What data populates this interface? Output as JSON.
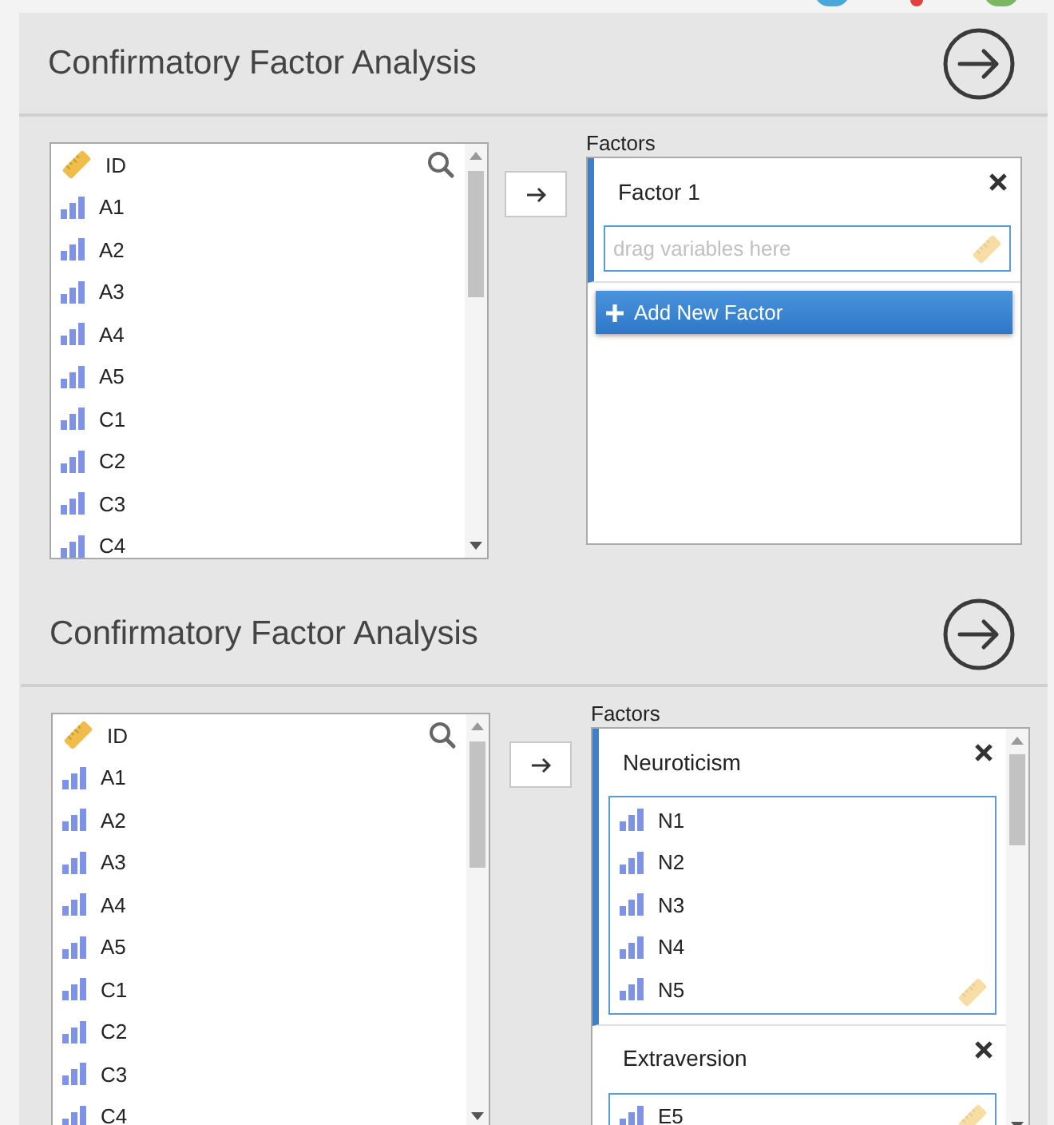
{
  "panels": [
    {
      "title": "Confirmatory Factor Analysis",
      "variables": [
        {
          "name": "ID",
          "kind": "id"
        },
        {
          "name": "A1",
          "kind": "ordinal"
        },
        {
          "name": "A2",
          "kind": "ordinal"
        },
        {
          "name": "A3",
          "kind": "ordinal"
        },
        {
          "name": "A4",
          "kind": "ordinal"
        },
        {
          "name": "A5",
          "kind": "ordinal"
        },
        {
          "name": "C1",
          "kind": "ordinal"
        },
        {
          "name": "C2",
          "kind": "ordinal"
        },
        {
          "name": "C3",
          "kind": "ordinal"
        },
        {
          "name": "C4",
          "kind": "ordinal"
        }
      ],
      "factors_label": "Factors",
      "factors": [
        {
          "title": "Factor 1",
          "placeholder": "drag variables here"
        }
      ],
      "add_button": "Add New Factor"
    },
    {
      "title": "Confirmatory Factor Analysis",
      "variables": [
        {
          "name": "ID",
          "kind": "id"
        },
        {
          "name": "A1",
          "kind": "ordinal"
        },
        {
          "name": "A2",
          "kind": "ordinal"
        },
        {
          "name": "A3",
          "kind": "ordinal"
        },
        {
          "name": "A4",
          "kind": "ordinal"
        },
        {
          "name": "A5",
          "kind": "ordinal"
        },
        {
          "name": "C1",
          "kind": "ordinal"
        },
        {
          "name": "C2",
          "kind": "ordinal"
        },
        {
          "name": "C3",
          "kind": "ordinal"
        },
        {
          "name": "C4",
          "kind": "ordinal"
        }
      ],
      "factors_label": "Factors",
      "factors": [
        {
          "title": "Neuroticism",
          "variables": [
            {
              "name": "N1",
              "kind": "ordinal"
            },
            {
              "name": "N2",
              "kind": "ordinal"
            },
            {
              "name": "N3",
              "kind": "ordinal"
            },
            {
              "name": "N4",
              "kind": "ordinal"
            },
            {
              "name": "N5",
              "kind": "ordinal"
            }
          ]
        },
        {
          "title": "Extraversion",
          "variables": [
            {
              "name": "E5",
              "kind": "ordinal"
            }
          ]
        }
      ]
    }
  ]
}
